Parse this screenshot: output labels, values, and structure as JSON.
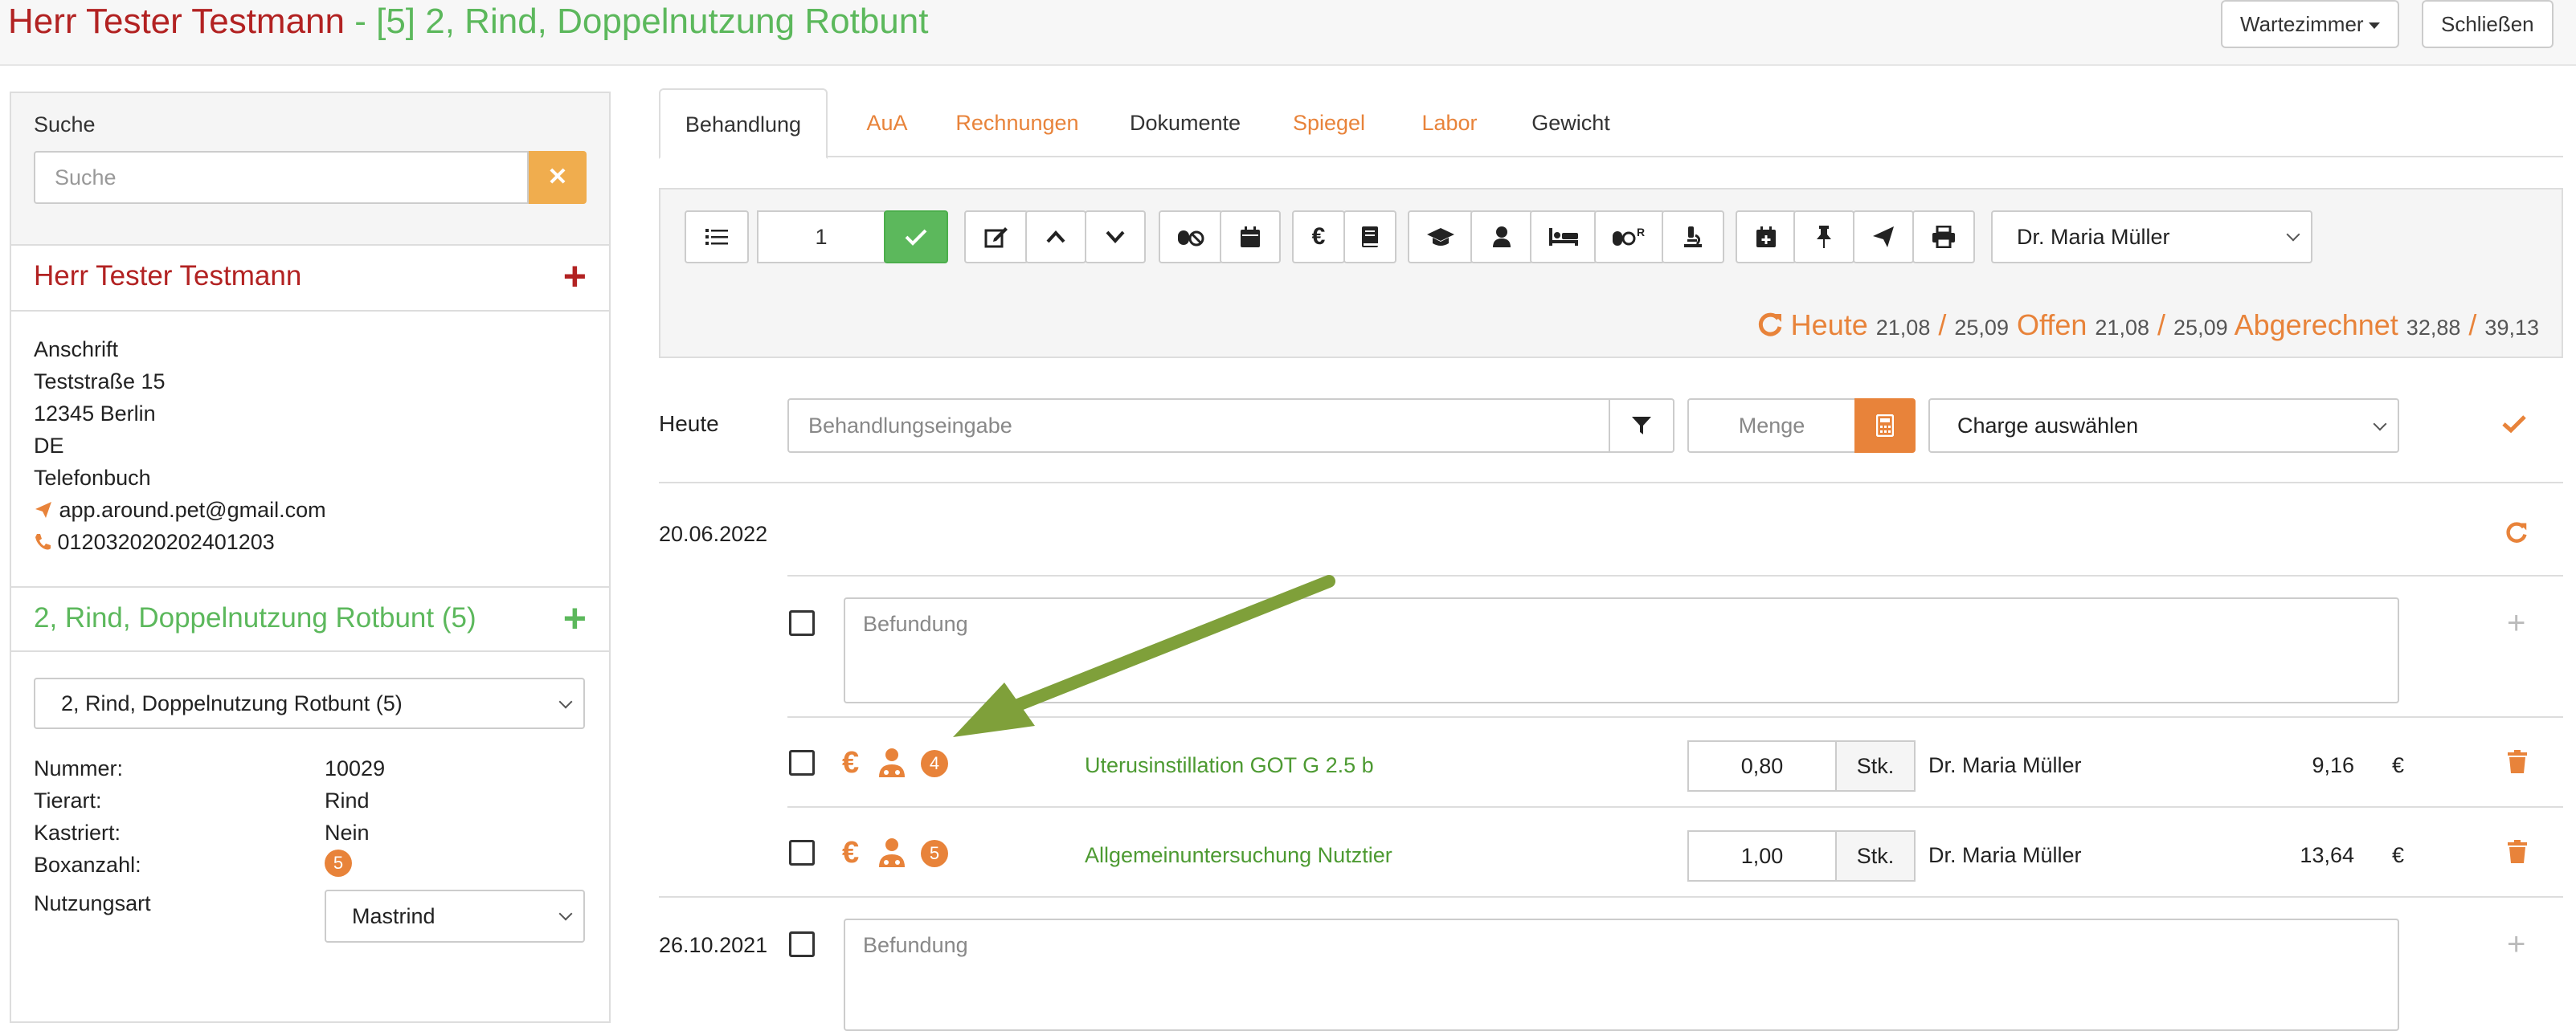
{
  "header": {
    "owner": "Herr Tester Testmann",
    "separator": " - ",
    "animal": "[5] 2, Rind, Doppelnutzung Rotbunt",
    "waiting_room_label": "Wartezimmer",
    "close_label": "Schließen"
  },
  "sidebar": {
    "search_label": "Suche",
    "search_placeholder": "Suche",
    "owner_name": "Herr Tester Testmann",
    "address": {
      "heading": "Anschrift",
      "street": "Teststraße 15",
      "city": "12345  Berlin",
      "country": "DE",
      "phonebook": "Telefonbuch",
      "email": "app.around.pet@gmail.com",
      "phone": "012032020202401203"
    },
    "animal_heading": "2, Rind, Doppelnutzung Rotbunt (5)",
    "animal_select": "2, Rind, Doppelnutzung Rotbunt (5)",
    "details": {
      "number_label": "Nummer:",
      "number_value": "10029",
      "species_label": "Tierart:",
      "species_value": "Rind",
      "neutered_label": "Kastriert:",
      "neutered_value": "Nein",
      "box_label": "Boxanzahl:",
      "box_value": "5",
      "usage_label": "Nutzungsart",
      "usage_value": "Mastrind"
    }
  },
  "tabs": [
    {
      "label": "Behandlung"
    },
    {
      "label": "AuA"
    },
    {
      "label": "Rechnungen"
    },
    {
      "label": "Dokumente"
    },
    {
      "label": "Spiegel"
    },
    {
      "label": "Labor"
    },
    {
      "label": "Gewicht"
    }
  ],
  "toolbar": {
    "quantity": "1",
    "doctor": "Dr. Maria Müller",
    "totals": {
      "today_label": "Heute",
      "today_a": "21,08",
      "today_b": "25,09",
      "open_label": "Offen",
      "open_a": "21,08",
      "open_b": "25,09",
      "billed_label": "Abgerechnet",
      "billed_a": "32,88",
      "billed_b": "39,13",
      "slash": "/"
    }
  },
  "entry": {
    "date_label": "Heute",
    "treatment_placeholder": "Behandlungseingabe",
    "amount_placeholder": "Menge",
    "batch_select": "Charge auswählen"
  },
  "treatments": [
    {
      "date": "20.06.2022",
      "finding_placeholder": "Befundung",
      "items": [
        {
          "badge": "4",
          "name": "Uterusinstillation GOT G 2.5 b",
          "qty": "0,80",
          "unit": "Stk.",
          "doctor": "Dr. Maria Müller",
          "price": "9,16",
          "currency": "€"
        },
        {
          "badge": "5",
          "name": "Allgemeinuntersuchung Nutztier",
          "qty": "1,00",
          "unit": "Stk.",
          "doctor": "Dr. Maria Müller",
          "price": "13,64",
          "currency": "€"
        }
      ]
    },
    {
      "date": "26.10.2021",
      "finding_placeholder": "Befundung"
    }
  ],
  "colors": {
    "brand_red": "#b22222",
    "brand_green": "#5cb85c",
    "accent_orange": "#e8833a",
    "annotation_arrow": "#7fa03a"
  }
}
